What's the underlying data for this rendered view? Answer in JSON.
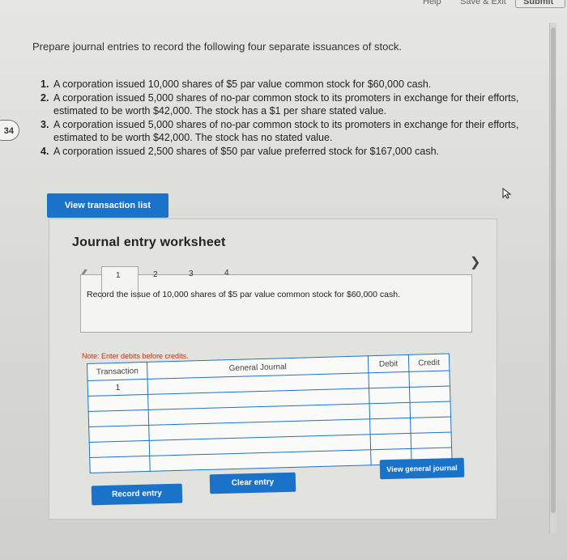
{
  "topbar": {
    "help": "Help",
    "save_exit": "Save & Exit",
    "submit": "Submit"
  },
  "question_badge": "34",
  "prompt": "Prepare journal entries to record the following four separate issuances of stock.",
  "issuances": [
    {
      "num": "1.",
      "text": "A corporation issued 10,000 shares of $5 par value common stock for $60,000 cash."
    },
    {
      "num": "2.",
      "text": "A corporation issued 5,000 shares of no-par common stock to its promoters in exchange for their efforts, estimated to be worth $42,000. The stock has a $1 per share stated value."
    },
    {
      "num": "3.",
      "text": "A corporation issued 5,000 shares of no-par common stock to its promoters in exchange for their efforts, estimated to be worth $42,000. The stock has no stated value."
    },
    {
      "num": "4.",
      "text": "A corporation issued 2,500 shares of $50 par value preferred stock for $167,000 cash."
    }
  ],
  "view_transaction_list": "View transaction list",
  "worksheet": {
    "title": "Journal entry worksheet",
    "tabs": [
      "1",
      "2",
      "3",
      "4"
    ],
    "active_tab": "1",
    "record_text": "Record the issue of 10,000 shares of $5 par value common stock for $60,000 cash.",
    "note": "Note: Enter debits before credits.",
    "columns": {
      "transaction": "Transaction",
      "general_journal": "General Journal",
      "debit": "Debit",
      "credit": "Credit"
    },
    "rows": [
      {
        "transaction": "1",
        "account": "",
        "debit": "",
        "credit": ""
      },
      {
        "transaction": "",
        "account": "",
        "debit": "",
        "credit": ""
      },
      {
        "transaction": "",
        "account": "",
        "debit": "",
        "credit": ""
      },
      {
        "transaction": "",
        "account": "",
        "debit": "",
        "credit": ""
      },
      {
        "transaction": "",
        "account": "",
        "debit": "",
        "credit": ""
      },
      {
        "transaction": "",
        "account": "",
        "debit": "",
        "credit": ""
      }
    ],
    "buttons": {
      "record": "Record entry",
      "clear": "Clear entry",
      "view_general": "View general journal"
    }
  },
  "colors": {
    "accent": "#1a73c9",
    "note": "#b13a1b"
  }
}
